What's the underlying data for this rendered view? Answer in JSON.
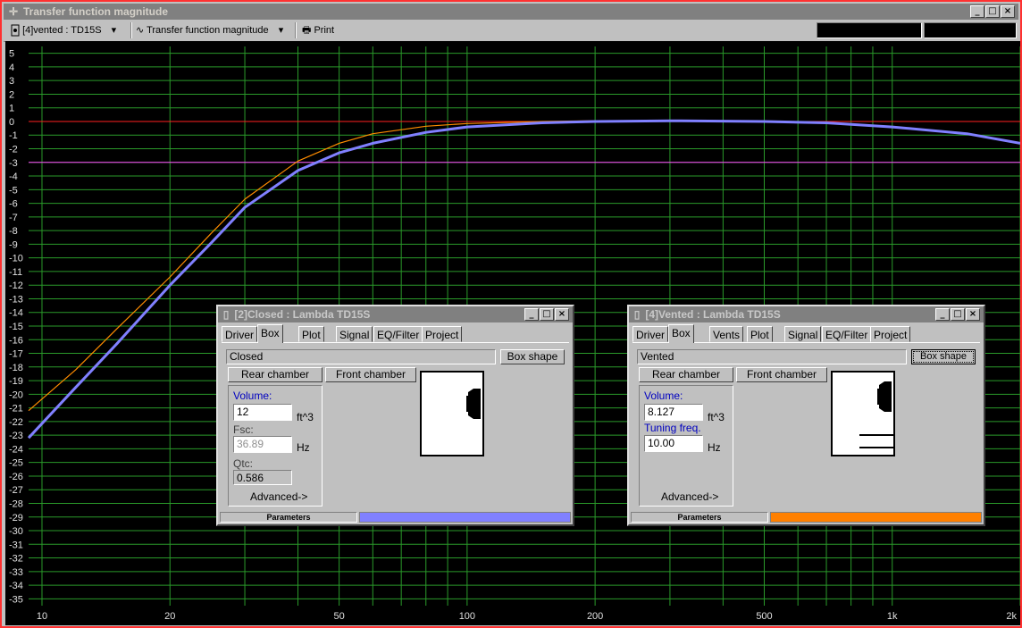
{
  "window": {
    "title": "Transfer function magnitude",
    "icon": "crosshair-icon",
    "minimize": "_",
    "maximize": "□",
    "close": "×"
  },
  "toolbar": {
    "project_label": "[4]vented : TD15S",
    "plot_label": "Transfer function magnitude",
    "print_label": "Print"
  },
  "plot": {
    "yticks": [
      "5",
      "4",
      "3",
      "2",
      "1",
      "0",
      "-1",
      "-2",
      "-3",
      "-4",
      "-5",
      "-6",
      "-7",
      "-8",
      "-9",
      "-10",
      "-11",
      "-12",
      "-13",
      "-14",
      "-15",
      "-16",
      "-17",
      "-18",
      "-19",
      "-20",
      "-21",
      "-22",
      "-23",
      "-24",
      "-25",
      "-26",
      "-27",
      "-28",
      "-29",
      "-30",
      "-31",
      "-32",
      "-33",
      "-34",
      "-35"
    ],
    "xticks": [
      "10",
      "20",
      "50",
      "100",
      "200",
      "500",
      "1k",
      "2k"
    ]
  },
  "chart_data": {
    "type": "line",
    "title": "Transfer function magnitude",
    "xlabel": "",
    "ylabel": "",
    "xscale": "log",
    "xlim": [
      9.3,
      2000
    ],
    "ylim": [
      -35.5,
      5.5
    ],
    "grid": true,
    "reference_lines": [
      {
        "y": 0,
        "color": "#ff2020"
      },
      {
        "y": -3,
        "color": "#ff40ff"
      }
    ],
    "series": [
      {
        "color": "#8080ff",
        "x": [
          9.3,
          12,
          15,
          20,
          25,
          30,
          40,
          50,
          60,
          80,
          100,
          150,
          200,
          300,
          500,
          700,
          1000,
          1500,
          2000
        ],
        "y": [
          -23.2,
          -19.5,
          -16.3,
          -12,
          -8.9,
          -6.3,
          -3.6,
          -2.3,
          -1.6,
          -0.8,
          -0.4,
          -0.1,
          0,
          0.05,
          0,
          -0.1,
          -0.4,
          -0.9,
          -1.6
        ]
      },
      {
        "color": "#ff8c00",
        "x": [
          9.3,
          12,
          15,
          20,
          25,
          30,
          40,
          50,
          60,
          80,
          100,
          150,
          200,
          300,
          500,
          700,
          1000,
          1500,
          2000
        ],
        "y": [
          -21.2,
          -18.2,
          -15.2,
          -11.4,
          -8.2,
          -5.7,
          -2.9,
          -1.6,
          -0.9,
          -0.35,
          -0.15,
          0,
          0.05,
          0.05,
          0,
          -0.1,
          -0.4,
          -0.9,
          -1.6
        ]
      }
    ]
  },
  "closed_win": {
    "title": "[2]Closed : Lambda TD15S",
    "tabs": [
      "Driver",
      "Box",
      "Plot",
      "Signal",
      "EQ/Filter",
      "Project"
    ],
    "active_tab": "Box",
    "box_type": "Closed",
    "box_shape_btn": "Box shape",
    "rear_chamber_btn": "Rear chamber",
    "front_chamber_btn": "Front chamber",
    "volume_label": "Volume:",
    "volume_value": "12",
    "volume_unit": "ft^3",
    "fsc_label": "Fsc:",
    "fsc_value": "36.89",
    "fsc_unit": "Hz",
    "qtc_label": "Qtc:",
    "qtc_value": "0.586",
    "advanced_label": "Advanced->",
    "status_label": "Parameters",
    "color": "#8080ff"
  },
  "vented_win": {
    "title": "[4]Vented : Lambda TD15S",
    "tabs": [
      "Driver",
      "Box",
      "Vents",
      "Plot",
      "Signal",
      "EQ/Filter",
      "Project"
    ],
    "active_tab": "Box",
    "box_type": "Vented",
    "box_shape_btn": "Box shape",
    "rear_chamber_btn": "Rear chamber",
    "front_chamber_btn": "Front chamber",
    "volume_label": "Volume:",
    "volume_value": "8.127",
    "volume_unit": "ft^3",
    "tuning_label": "Tuning freq.",
    "tuning_value": "10.00",
    "tuning_unit": "Hz",
    "advanced_label": "Advanced->",
    "status_label": "Parameters",
    "color": "#ff8000"
  }
}
